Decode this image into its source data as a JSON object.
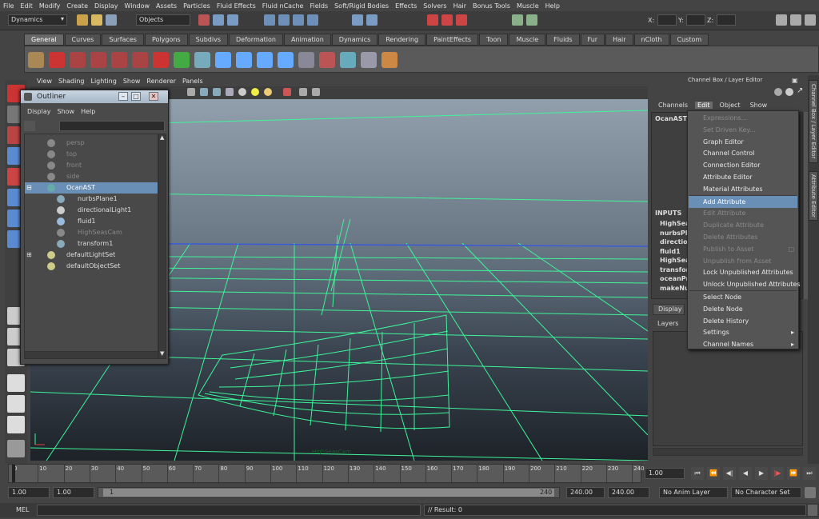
{
  "menubar": [
    "File",
    "Edit",
    "Modify",
    "Create",
    "Display",
    "Window",
    "Assets",
    "Particles",
    "Fluid Effects",
    "Fluid nCache",
    "Fields",
    "Soft/Rigid Bodies",
    "Effects",
    "Solvers",
    "Hair",
    "Bonus Tools",
    "Muscle",
    "Help"
  ],
  "status_line": {
    "menu_set": "Dynamics",
    "selection_mode": "Objects",
    "x_label": "X:",
    "y_label": "Y:",
    "z_label": "Z:"
  },
  "shelf_tabs": [
    "General",
    "Curves",
    "Surfaces",
    "Polygons",
    "Subdivs",
    "Deformation",
    "Animation",
    "Dynamics",
    "Rendering",
    "PaintEffects",
    "Toon",
    "Muscle",
    "Fluids",
    "Fur",
    "Hair",
    "nCloth",
    "Custom"
  ],
  "shelf_active": "General",
  "panel_menu": [
    "View",
    "Shading",
    "Lighting",
    "Show",
    "Renderer",
    "Panels"
  ],
  "viewport": {
    "camera_label": "HighSeasCam"
  },
  "outliner": {
    "title": "Outliner",
    "menu": [
      "Display",
      "Show",
      "Help"
    ],
    "items": [
      {
        "label": "persp",
        "dim": true
      },
      {
        "label": "top",
        "dim": true
      },
      {
        "label": "front",
        "dim": true
      },
      {
        "label": "side",
        "dim": true
      },
      {
        "label": "OcanAST",
        "selected": true
      },
      {
        "label": "nurbsPlane1"
      },
      {
        "label": "directionalLight1"
      },
      {
        "label": "fluid1"
      },
      {
        "label": "HighSeasCam",
        "dim": true
      },
      {
        "label": "transform1"
      },
      {
        "label": "defaultLightSet"
      },
      {
        "label": "defaultObjectSet"
      }
    ]
  },
  "channel_box": {
    "title": "Channel Box / Layer Editor",
    "menu": [
      "Channels",
      "Edit",
      "Object",
      "Show"
    ],
    "open_menu": "Edit",
    "node": "OcanAST",
    "inputs_label": "INPUTS",
    "inputs": [
      "HighSea",
      "nurbsPla",
      "direction",
      "fluid1",
      "HighSea",
      "transfor",
      "oceanPr",
      "makeNu"
    ],
    "side_tabs": [
      "Channel Box / Layer Editor",
      "Attribute Editor"
    ]
  },
  "edit_menu": [
    {
      "label": "Expressions...",
      "disabled": true
    },
    {
      "label": "Set Driven Key...",
      "disabled": true
    },
    {
      "label": "Graph Editor"
    },
    {
      "label": "Channel Control"
    },
    {
      "label": "Connection Editor"
    },
    {
      "label": "Attribute Editor"
    },
    {
      "label": "Material Attributes"
    },
    {
      "label": "Add Attribute",
      "highlighted": true
    },
    {
      "label": "Edit Attribute",
      "disabled": true
    },
    {
      "label": "Duplicate Attribute",
      "disabled": true
    },
    {
      "label": "Delete Attributes",
      "disabled": true
    },
    {
      "label": "Publish to Asset",
      "disabled": true
    },
    {
      "label": "Unpublish from Asset",
      "disabled": true
    },
    {
      "label": "Lock Unpublished Attributes"
    },
    {
      "label": "Unlock Unpublished Attributes"
    },
    {
      "label": "Select Node"
    },
    {
      "label": "Delete Node"
    },
    {
      "label": "Delete History"
    },
    {
      "label": "Settings",
      "submenu": true
    },
    {
      "label": "Channel Names",
      "submenu": true
    }
  ],
  "layer_editor": {
    "tab": "Display",
    "menu_layers": "Layers"
  },
  "timeline": {
    "ticks": [
      "0",
      "10",
      "20",
      "30",
      "40",
      "50",
      "60",
      "70",
      "80",
      "90",
      "100",
      "110",
      "120",
      "130",
      "140",
      "150",
      "160",
      "170",
      "180",
      "190",
      "200",
      "210",
      "220",
      "230",
      "240"
    ],
    "current_frame": "1.00"
  },
  "range": {
    "start_time": "1.00",
    "playback_start": "1.00",
    "range_start": "1",
    "range_end": "240",
    "playback_end": "240.00",
    "end_time": "240.00",
    "anim_layer": "No Anim Layer",
    "character_set": "No Character Set"
  },
  "command_line": {
    "label": "MEL",
    "result": "// Result: 0"
  },
  "colors": {
    "wire": "#3df59a",
    "selection": "#6a8fb7"
  }
}
